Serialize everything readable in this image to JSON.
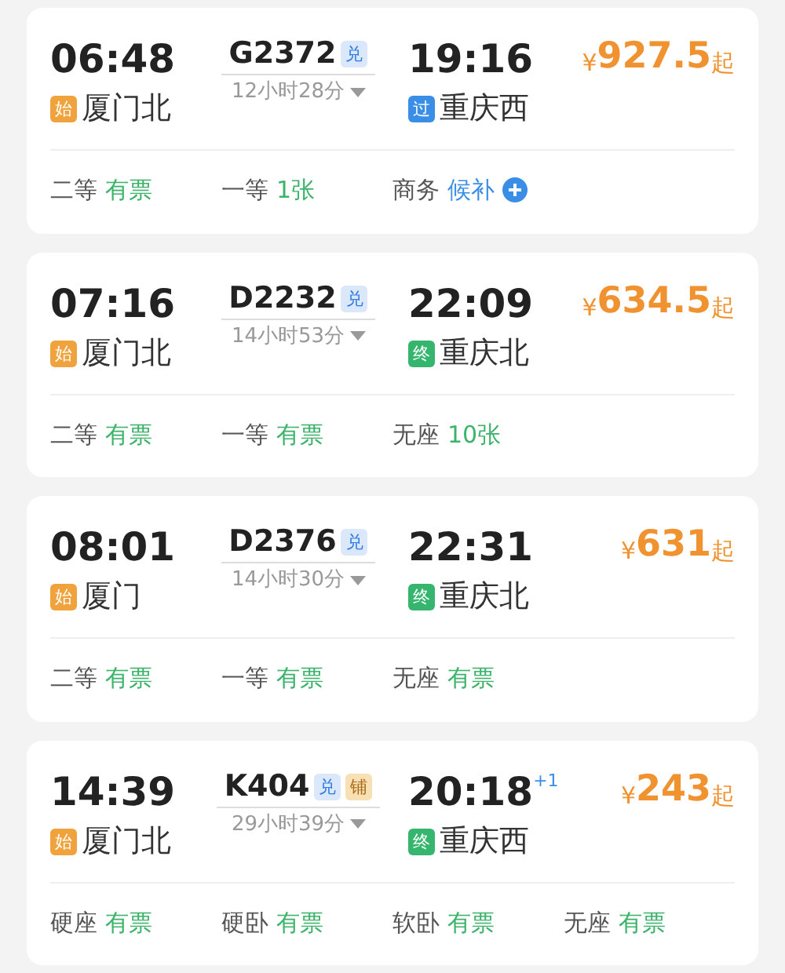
{
  "trains": [
    {
      "depart_time": "06:48",
      "train_no": "G2372",
      "tags": [
        {
          "kind": "exchange",
          "label": "兑"
        }
      ],
      "duration": "12小时28分",
      "arrive_time": "19:16",
      "price_symbol": "¥",
      "price": "927.5",
      "price_suffix": "起",
      "from": {
        "kind": "start",
        "badge": "始",
        "name": "厦门北"
      },
      "to": {
        "kind": "pass",
        "badge": "过",
        "name": "重庆西"
      },
      "seats": [
        {
          "class": "二等",
          "status": "有票",
          "kind": "available"
        },
        {
          "class": "一等",
          "status": "1张",
          "kind": "available"
        },
        {
          "class": "商务",
          "status": "候补",
          "kind": "waitlist"
        }
      ]
    },
    {
      "depart_time": "07:16",
      "train_no": "D2232",
      "tags": [
        {
          "kind": "exchange",
          "label": "兑"
        }
      ],
      "duration": "14小时53分",
      "arrive_time": "22:09",
      "price_symbol": "¥",
      "price": "634.5",
      "price_suffix": "起",
      "from": {
        "kind": "start",
        "badge": "始",
        "name": "厦门北"
      },
      "to": {
        "kind": "end",
        "badge": "终",
        "name": "重庆北"
      },
      "seats": [
        {
          "class": "二等",
          "status": "有票",
          "kind": "available"
        },
        {
          "class": "一等",
          "status": "有票",
          "kind": "available"
        },
        {
          "class": "无座",
          "status": "10张",
          "kind": "available"
        }
      ]
    },
    {
      "depart_time": "08:01",
      "train_no": "D2376",
      "tags": [
        {
          "kind": "exchange",
          "label": "兑"
        }
      ],
      "duration": "14小时30分",
      "arrive_time": "22:31",
      "price_symbol": "¥",
      "price": "631",
      "price_suffix": "起",
      "from": {
        "kind": "start",
        "badge": "始",
        "name": "厦门"
      },
      "to": {
        "kind": "end",
        "badge": "终",
        "name": "重庆北"
      },
      "seats": [
        {
          "class": "二等",
          "status": "有票",
          "kind": "available"
        },
        {
          "class": "一等",
          "status": "有票",
          "kind": "available"
        },
        {
          "class": "无座",
          "status": "有票",
          "kind": "available"
        }
      ]
    },
    {
      "depart_time": "14:39",
      "train_no": "K404",
      "tags": [
        {
          "kind": "exchange",
          "label": "兑"
        },
        {
          "kind": "berth",
          "label": "铺"
        }
      ],
      "duration": "29小时39分",
      "arrive_time": "20:18",
      "day_offset": "+1",
      "price_symbol": "¥",
      "price": "243",
      "price_suffix": "起",
      "from": {
        "kind": "start",
        "badge": "始",
        "name": "厦门北"
      },
      "to": {
        "kind": "end",
        "badge": "终",
        "name": "重庆西"
      },
      "seats": [
        {
          "class": "硬座",
          "status": "有票",
          "kind": "available"
        },
        {
          "class": "硬卧",
          "status": "有票",
          "kind": "available"
        },
        {
          "class": "软卧",
          "status": "有票",
          "kind": "available"
        },
        {
          "class": "无座",
          "status": "有票",
          "kind": "available"
        }
      ]
    }
  ]
}
